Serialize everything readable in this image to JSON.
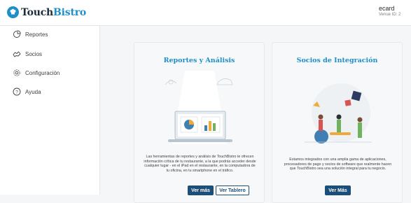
{
  "header": {
    "logo_touch": "Touch",
    "logo_bistro": "Bistro",
    "account_name": "ecard",
    "venue_label": "Venue ID: 2"
  },
  "sidebar": {
    "items": [
      {
        "label": "Reportes",
        "icon": "reports-icon"
      },
      {
        "label": "Socios",
        "icon": "partners-icon"
      },
      {
        "label": "Configuración",
        "icon": "gear-icon"
      },
      {
        "label": "Ayuda",
        "icon": "help-icon"
      }
    ]
  },
  "cards": {
    "reports": {
      "title": "Reportes y Análisis",
      "description": "Las herramientas de reportes y análisis de TouchBistro te ofrecen información crítica de tu restaurante, a la que podrás acceder desde cualquier lugar - en el iPad en el restaurante, en la computadora de tu oficina, en tu smartphone en el tráfico.",
      "primary_button": "Ver más",
      "secondary_button": "Ver Tablero"
    },
    "partners": {
      "title": "Socios de Integración",
      "description": "Estamos integrados con una amplia gama de aplicaciones, procesadores de pago y socios de software que realmente hacen que TouchBistro sea una solución integral para tu negocio.",
      "primary_button": "Ver Más"
    }
  },
  "colors": {
    "brand_blue": "#1f8fc9",
    "button_navy": "#1b4e78"
  }
}
